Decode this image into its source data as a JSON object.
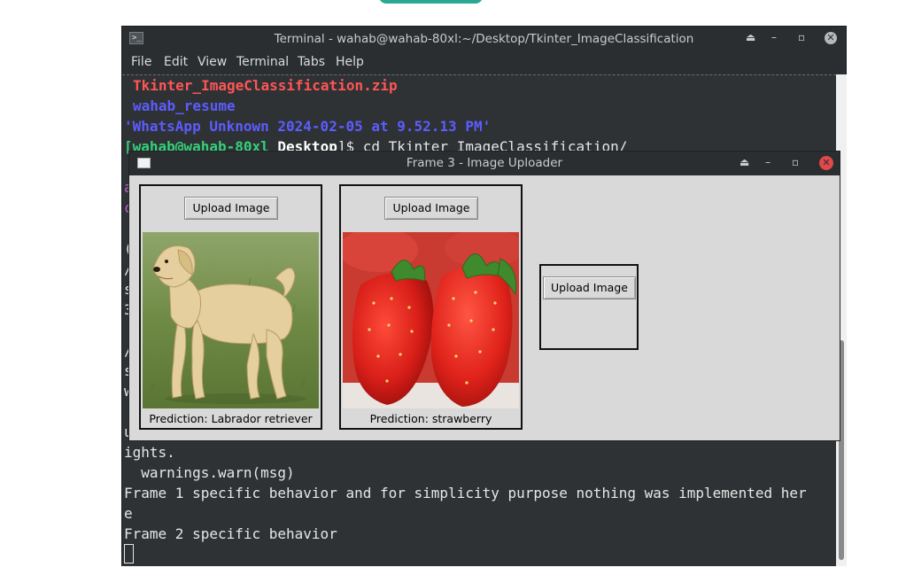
{
  "terminal": {
    "title": "Terminal - wahab@wahab-80xl:~/Desktop/Tkinter_ImageClassification",
    "icon": "terminal-icon",
    "menu": [
      "File",
      "Edit",
      "View",
      "Terminal",
      "Tabs",
      "Help"
    ],
    "lines": {
      "l1": "Tkinter_ImageClassification.zip",
      "l2": "wahab_resume",
      "l3": "'WhatsApp Unknown 2024-02-05 at 9.52.13 PM'",
      "l4_user": "[wahab@wahab-80xl",
      "l4_dir": " Desktop",
      "l4_cmd": "]$ cd Tkinter_ImageClassification/",
      "l5": "ights.",
      "l6": "  warnings.warn(msg)",
      "l7": "Frame 1 specific behavior and for simplicity purpose nothing was implemented her",
      "l8": "e",
      "l9": "Frame 2 specific behavior"
    },
    "left_fragments": [
      "a",
      "c",
      "(",
      "/",
      "s",
      "3",
      "/",
      "s",
      "w",
      "u"
    ],
    "colors": {
      "red": "#ff5555",
      "blue": "#5c5cff",
      "green": "#33d17a",
      "magenta": "#c061cb"
    }
  },
  "tk_window": {
    "title": "Frame 3 - Image Uploader",
    "frames": [
      {
        "button": "Upload Image",
        "prediction": "Prediction: Labrador retriever",
        "image": "labrador-dog"
      },
      {
        "button": "Upload Image",
        "prediction": "Prediction: strawberry",
        "image": "strawberries"
      },
      {
        "button": "Upload Image"
      }
    ]
  }
}
